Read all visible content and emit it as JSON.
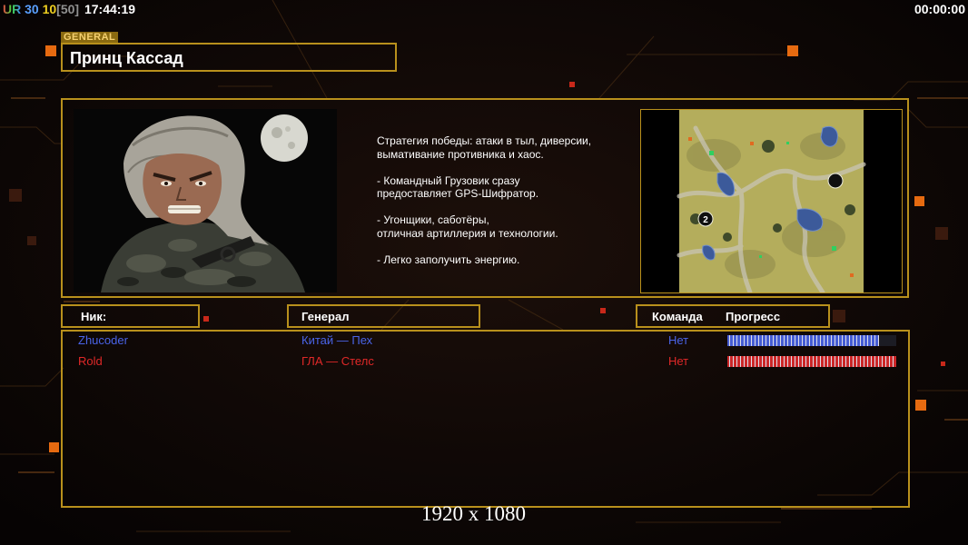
{
  "hud": {
    "ur_label": "UR",
    "num1": "30",
    "num2": "10",
    "num3": "[50]",
    "clock": "17:44:19",
    "timer": "00:00:00"
  },
  "general": {
    "tag": "GENERAL",
    "name": "Принц Кассад"
  },
  "description": [
    "Стратегия победы: атаки в тыл, диверсии,\n вымативание противника и хаос.",
    "- Командный Грузовик сразу\nпредоставляет GPS-Шифратор.",
    "- Угонщики, саботёры,\nотличная артиллерия и технологии.",
    "- Легко заполучить энергию."
  ],
  "map": {
    "marker": "2"
  },
  "headers": {
    "nick": "Ник:",
    "general": "Генерал",
    "team": "Команда",
    "progress": "Прогресс"
  },
  "players": [
    {
      "nick": "Zhucoder",
      "general": "Китай — Пех",
      "team": "Нет",
      "progress": 0.9,
      "color": "#4a64e8"
    },
    {
      "nick": "Rold",
      "general": "ГЛА — Стелс",
      "team": "Нет",
      "progress": 1.0,
      "color": "#e02828"
    }
  ],
  "resolution": "1920 x 1080",
  "colors": {
    "frame": "#b8901c",
    "accent_orange": "#e66a10"
  }
}
